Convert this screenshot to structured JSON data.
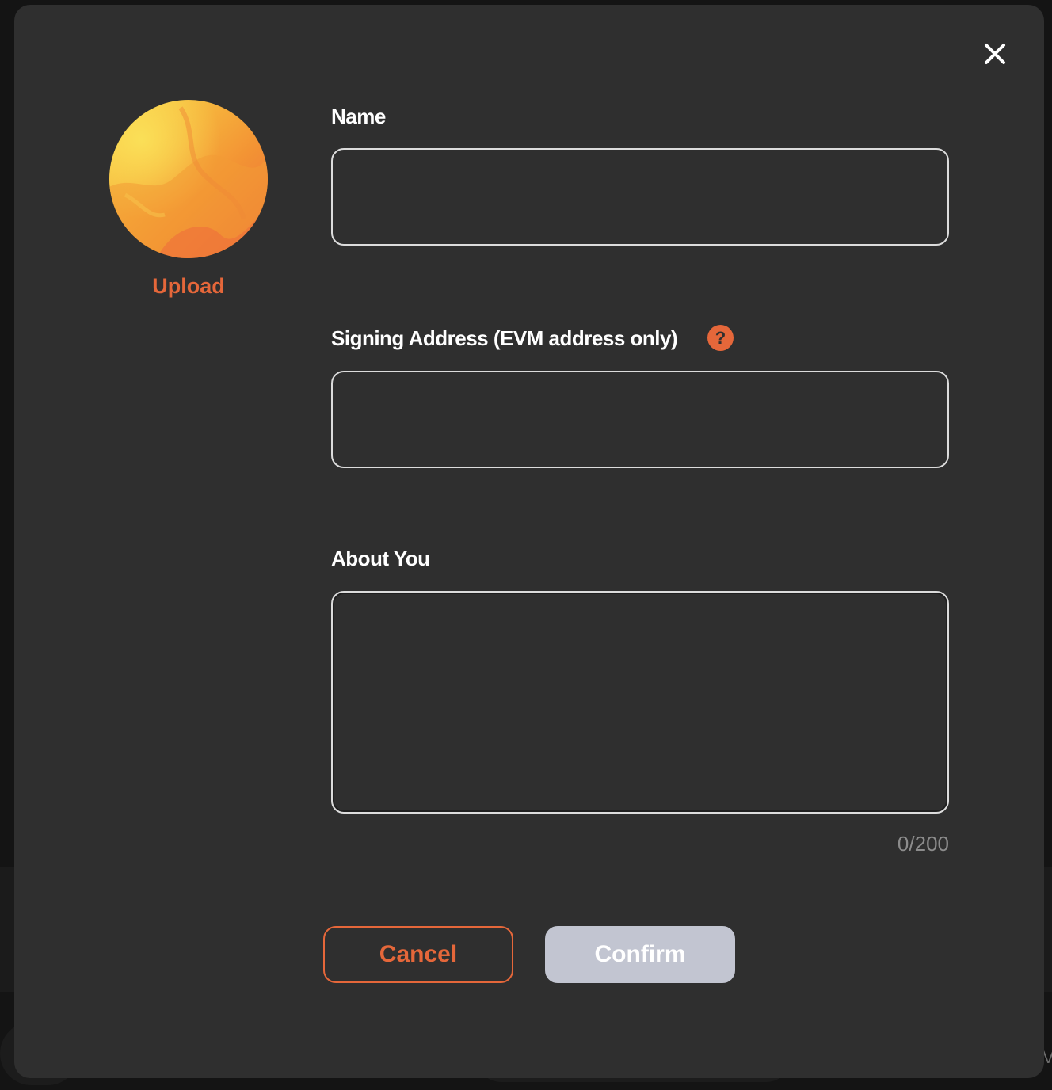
{
  "modal": {
    "close_icon": "close-icon",
    "avatar": {
      "icon": "avatar-image",
      "upload_label": "Upload"
    },
    "fields": {
      "name": {
        "label": "Name",
        "value": "",
        "placeholder": ""
      },
      "signing_address": {
        "label": "Signing Address (EVM address only)",
        "help_icon": "question-mark-icon",
        "help_glyph": "?",
        "value": "",
        "placeholder": ""
      },
      "about": {
        "label": "About You",
        "value": "",
        "placeholder": "",
        "counter": "0/200"
      }
    },
    "buttons": {
      "cancel_label": "Cancel",
      "confirm_label": "Confirm"
    }
  },
  "background": {
    "edge_text": "V"
  },
  "colors": {
    "accent": "#e5673a",
    "modal_bg": "#2f2f2f",
    "confirm_disabled": "#c2c5d1",
    "input_border": "#dcdcdc"
  }
}
